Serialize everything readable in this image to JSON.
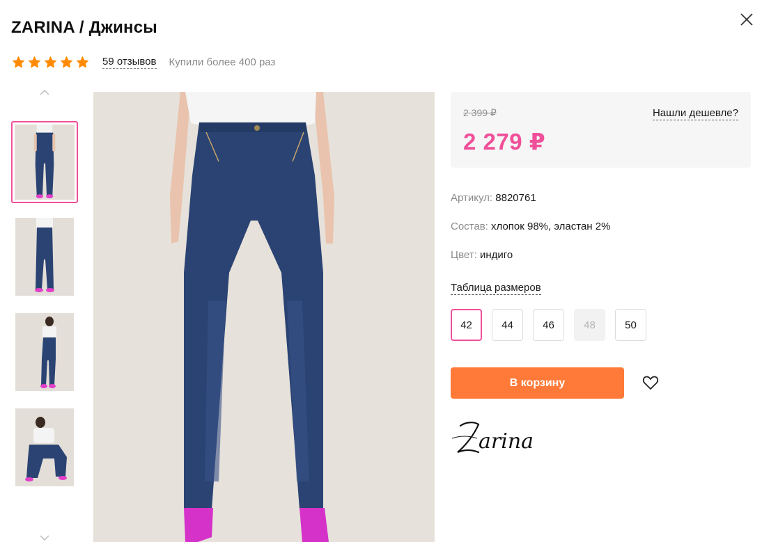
{
  "product": {
    "title": "ZARINA / Джинсы",
    "rating_stars": 5,
    "reviews_text": "59 отзывов",
    "bought_text": "Купили более 400 раз"
  },
  "price": {
    "old": "2 399 ₽",
    "current": "2 279 ₽",
    "cheaper_link": "Нашли дешевле?"
  },
  "details": {
    "article_label": "Артикул:",
    "article_value": "8820761",
    "composition_label": "Состав:",
    "composition_value": "хлопок 98%, эластан 2%",
    "color_label": "Цвет:",
    "color_value": "индиго"
  },
  "sizes": {
    "table_link": "Таблица размеров",
    "options": [
      {
        "label": "42",
        "state": "selected"
      },
      {
        "label": "44",
        "state": "available"
      },
      {
        "label": "46",
        "state": "available"
      },
      {
        "label": "48",
        "state": "unavailable"
      },
      {
        "label": "50",
        "state": "available"
      }
    ]
  },
  "actions": {
    "cart_label": "В корзину"
  },
  "brand": {
    "logo_text": "Zarina"
  },
  "gallery": {
    "thumbnails_count": 4,
    "active_index": 0
  },
  "colors": {
    "accent_pink": "#f0509a",
    "cart_orange": "#ff7a38",
    "star_orange": "#ff8a00",
    "denim": "#2a4373"
  },
  "icons": {
    "close": "close-icon",
    "star": "star-icon",
    "heart": "heart-icon",
    "chevron_up": "chevron-up-icon",
    "chevron_down": "chevron-down-icon"
  }
}
